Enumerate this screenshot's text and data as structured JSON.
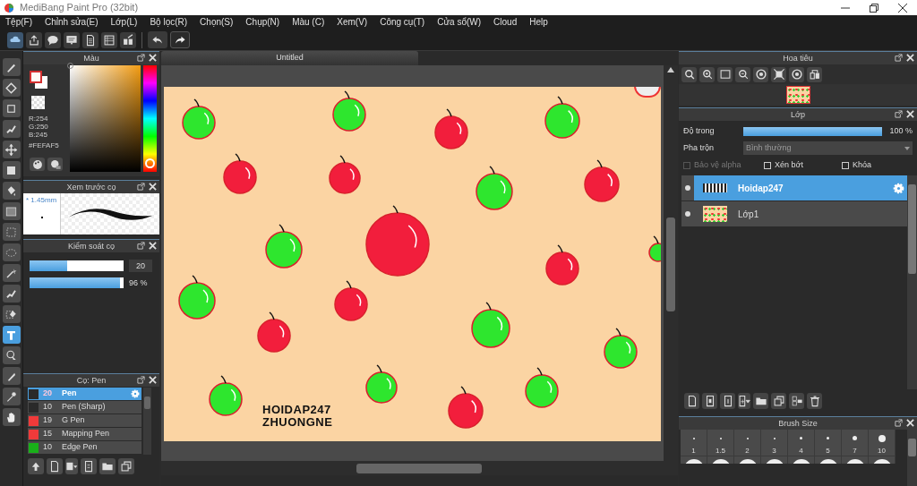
{
  "window": {
    "title": "MediBang Paint Pro (32bit)"
  },
  "menu": [
    "Tệp(F)",
    "Chỉnh sửa(E)",
    "Lớp(L)",
    "Bộ lọc(R)",
    "Chọn(S)",
    "Chụp(N)",
    "Màu (C)",
    "Xem(V)",
    "Công cụ(T)",
    "Cửa sổ(W)",
    "Cloud",
    "Help"
  ],
  "tools": [
    {
      "kind": "brush",
      "selected": false
    },
    {
      "kind": "eraser",
      "selected": false
    },
    {
      "kind": "dot",
      "selected": false
    },
    {
      "kind": "selpen",
      "selected": false
    },
    {
      "kind": "move",
      "selected": false
    },
    {
      "kind": "fill",
      "selected": false
    },
    {
      "kind": "bucket",
      "selected": false
    },
    {
      "kind": "gradient",
      "selected": false
    },
    {
      "kind": "selrect",
      "selected": false
    },
    {
      "kind": "lasso",
      "selected": false
    },
    {
      "kind": "wand",
      "selected": false
    },
    {
      "kind": "selpen",
      "selected": false
    },
    {
      "kind": "selerase",
      "selected": false
    },
    {
      "kind": "text",
      "selected": true
    },
    {
      "kind": "operation",
      "selected": false
    },
    {
      "kind": "divide",
      "selected": false
    },
    {
      "kind": "eyedropper",
      "selected": false
    },
    {
      "kind": "hand",
      "selected": false
    }
  ],
  "color_panel": {
    "title": "Màu",
    "rgb": [
      "R:254",
      "G:250",
      "B:245"
    ],
    "hex": "#FEFAF5",
    "hue": {
      "level": 0.03
    }
  },
  "brush_preview": {
    "title": "Xem trước cọ",
    "size": "* 1.45mm"
  },
  "brush_control": {
    "title": "Kiểm soát cọ",
    "sliders": [
      {
        "level": 0.4,
        "reading": "20"
      },
      {
        "level": 0.96,
        "reading": "96 %"
      }
    ]
  },
  "brushes": {
    "title": "Cọ: Pen",
    "items": [
      {
        "size": "20",
        "name": "Pen",
        "color": "#2a2a2a",
        "selected": true
      },
      {
        "size": "10",
        "name": "Pen (Sharp)",
        "color": "#2a2a2a",
        "selected": false
      },
      {
        "size": "19",
        "name": "G Pen",
        "color": "#f03a3a",
        "selected": false
      },
      {
        "size": "15",
        "name": "Mapping Pen",
        "color": "#f03a3a",
        "selected": false
      },
      {
        "size": "10",
        "name": "Edge Pen",
        "color": "#19b019",
        "selected": false
      }
    ]
  },
  "canvas": {
    "tab": "Untitled",
    "text": [
      "HOIDAP247",
      "ZHUONGNE"
    ]
  },
  "navigator": {
    "title": "Hoa tiêu"
  },
  "layers_panel": {
    "title": "Lớp",
    "opacity_label": "Độ trong",
    "opacity": {
      "level": 1,
      "reading": "100 %"
    },
    "blend_label": "Pha trộn",
    "blend": "Bình thường",
    "options": [
      {
        "label": "Bảo vệ alpha",
        "checked": false,
        "disabled": true
      },
      {
        "label": "Xén bớt",
        "checked": false,
        "disabled": false
      },
      {
        "label": "Khóa",
        "checked": false,
        "disabled": false
      }
    ],
    "layers": [
      {
        "name": "Hoidap247",
        "selected": true,
        "visible": true,
        "kind": "text"
      },
      {
        "name": "Lớp1",
        "selected": false,
        "visible": true,
        "kind": "image"
      }
    ]
  },
  "brush_size": {
    "title": "Brush Size",
    "sizes": [
      "1",
      "1.5",
      "2",
      "3",
      "4",
      "5",
      "7",
      "10"
    ]
  }
}
